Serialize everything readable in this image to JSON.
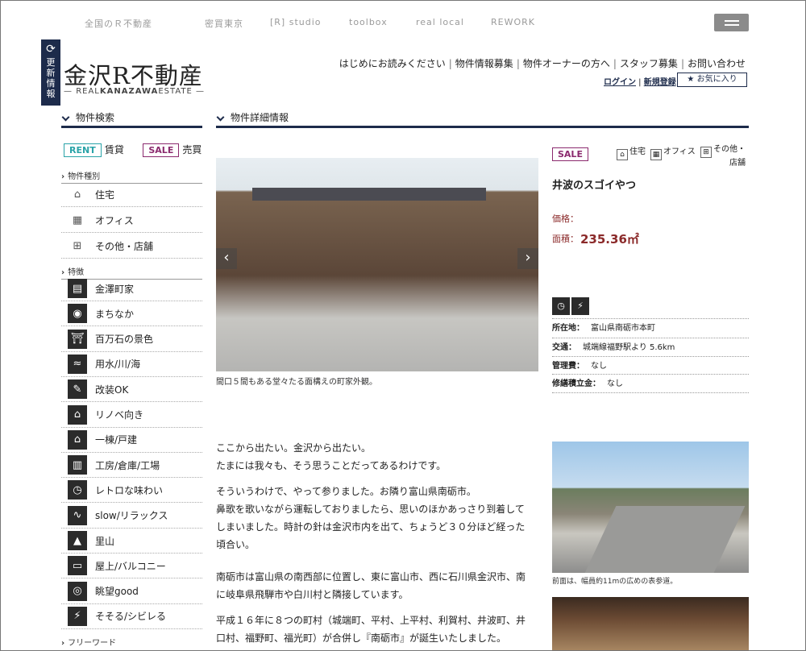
{
  "top_nav": [
    "全国のＲ不動産",
    "密買東京",
    "[R] studio",
    "toolbox",
    "real local",
    "REWORK"
  ],
  "update_tab": {
    "label": "更新情報"
  },
  "logo": {
    "jp": "金沢R不動産",
    "en_pre": "REAL",
    "en_bold": "KANAZAWA",
    "en_post": "ESTATE"
  },
  "header_links": [
    "はじめにお読みください",
    "物件情報募集",
    "物件オーナーの方へ",
    "スタッフ募集",
    "お問い合わせ"
  ],
  "account": {
    "login": "ログイン",
    "register": "新規登録",
    "favorites": "★ お気に入り"
  },
  "sidebar": {
    "title": "物件検索",
    "rent_tag": "RENT",
    "rent_label": "賃貸",
    "sale_tag": "SALE",
    "sale_label": "売買",
    "type_head": "物件種別",
    "types": [
      {
        "label": "住宅",
        "icon": "house-icon",
        "glyph": "⌂"
      },
      {
        "label": "オフィス",
        "icon": "office-icon",
        "glyph": "▦"
      },
      {
        "label": "その他・店舗",
        "icon": "store-icon",
        "glyph": "⊞"
      }
    ],
    "feature_head": "特徴",
    "features": [
      {
        "label": "金澤町家",
        "icon": "machiya-icon",
        "glyph": "▤"
      },
      {
        "label": "まちなか",
        "icon": "downtown-icon",
        "glyph": "◉"
      },
      {
        "label": "百万石の景色",
        "icon": "scenery-icon",
        "glyph": "⛩"
      },
      {
        "label": "用水/川/海",
        "icon": "water-icon",
        "glyph": "≈"
      },
      {
        "label": "改装OK",
        "icon": "renovation-icon",
        "glyph": "✎"
      },
      {
        "label": "リノベ向き",
        "icon": "renovate-house-icon",
        "glyph": "⌂"
      },
      {
        "label": "一棟/戸建",
        "icon": "detached-house-icon",
        "glyph": "⌂"
      },
      {
        "label": "工房/倉庫/工場",
        "icon": "factory-icon",
        "glyph": "▥"
      },
      {
        "label": "レトロな味わい",
        "icon": "retro-clock-icon",
        "glyph": "◷"
      },
      {
        "label": "slow/リラックス",
        "icon": "relax-icon",
        "glyph": "∿"
      },
      {
        "label": "里山",
        "icon": "mountain-icon",
        "glyph": "▲"
      },
      {
        "label": "屋上/バルコニー",
        "icon": "balcony-icon",
        "glyph": "▭"
      },
      {
        "label": "眺望good",
        "icon": "view-eye-icon",
        "glyph": "◎"
      },
      {
        "label": "そそる/シビレる",
        "icon": "lightning-icon",
        "glyph": "⚡"
      }
    ],
    "free_word": "フリーワード"
  },
  "detail": {
    "title": "物件詳細情報",
    "caption": "間口５間もある堂々たる面構えの町家外観。",
    "article": [
      "ここから出たい。金沢から出たい。\nたまには我々も、そう思うことだってあるわけです。",
      "そういうわけで、やって参りました。お隣り富山県南砺市。\n鼻歌を歌いながら運転しておりましたら、思いのほかあっさり到着してしまいました。時計の針は金沢市内を出て、ちょうど３０分ほど経った頃合い。",
      "南砺市は富山県の南西部に位置し、東に富山市、西に石川県金沢市、南に岐阜県飛騨市や白川村と隣接しています。",
      "平成１６年に８つの町村（城端町、平村、上平村、利賀村、井波町、井口村、福野町、福光町）が合併し『南砺市』が誕生いたしました。"
    ]
  },
  "property": {
    "status": "SALE",
    "types": [
      "住宅",
      "オフィス",
      "その他・\n店舗"
    ],
    "name": "井波のスゴイやつ",
    "price_label": "価格：",
    "area_label": "面積：",
    "area_value": "235.36㎡",
    "feature_icons": [
      "retro-clock-icon",
      "lightning-icon"
    ],
    "info": [
      {
        "label": "所在地：",
        "value": "富山県南砺市本町"
      },
      {
        "label": "交通：",
        "value": "城端線福野駅より 5.6km"
      },
      {
        "label": "管理費：",
        "value": "なし"
      },
      {
        "label": "修繕積立金：",
        "value": "なし"
      }
    ],
    "photo_caption": "前面は、幅員約11mの広めの表参道。"
  },
  "colors": {
    "navy": "#1d2b4b",
    "sale": "#8b2a6e",
    "rent": "#2aa3a8",
    "price": "#8b2a2a"
  }
}
